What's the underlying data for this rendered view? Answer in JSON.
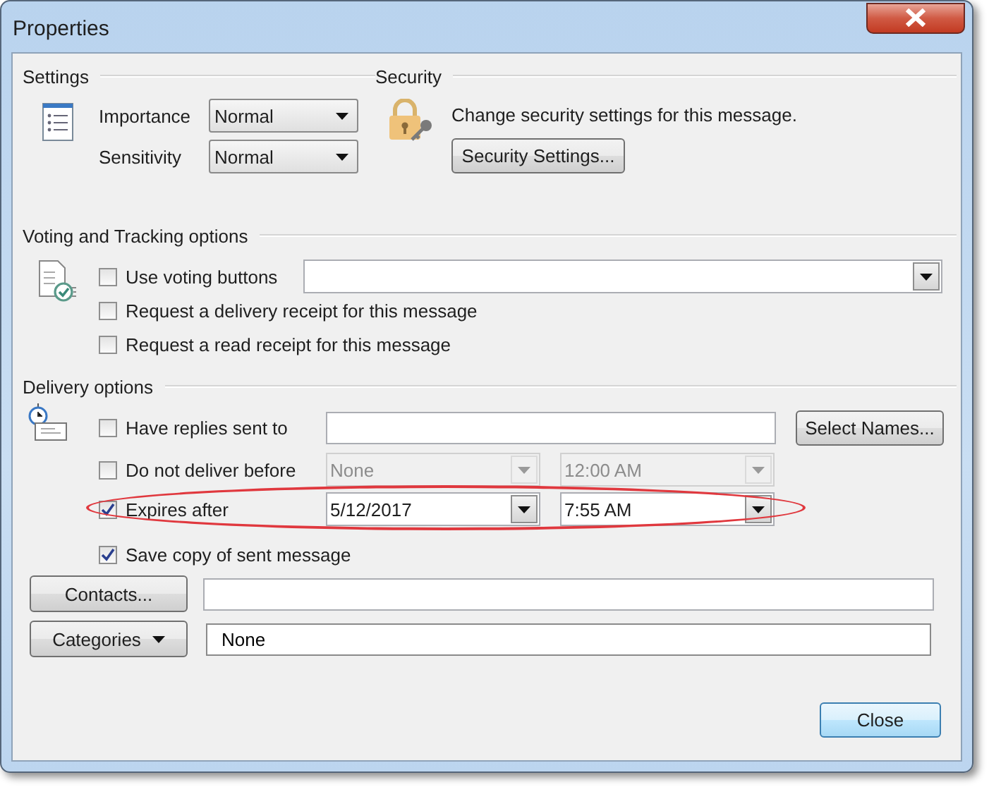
{
  "window": {
    "title": "Properties"
  },
  "settings": {
    "heading": "Settings",
    "fields": [
      {
        "label": "Importance",
        "value": "Normal"
      },
      {
        "label": "Sensitivity",
        "value": "Normal"
      }
    ]
  },
  "security": {
    "heading": "Security",
    "text": "Change security settings for this message.",
    "button": "Security Settings..."
  },
  "voting": {
    "heading": "Voting and Tracking options",
    "options": [
      {
        "kind": "combo",
        "label": "Use voting buttons",
        "checked": false
      },
      {
        "kind": "plain",
        "label": "Request a delivery receipt for this message",
        "checked": false
      },
      {
        "kind": "plain",
        "label": "Request a read receipt for this message",
        "checked": false
      }
    ]
  },
  "delivery": {
    "heading": "Delivery options",
    "rows": [
      {
        "kind": "replies",
        "label": "Have replies sent to",
        "checked": false,
        "button": "Select Names..."
      },
      {
        "kind": "schedule",
        "label": "Do not deliver before",
        "checked": false,
        "disabled": true,
        "date": "None",
        "time": "12:00 AM",
        "highlighted": false
      },
      {
        "kind": "schedule",
        "label": "Expires after",
        "checked": true,
        "disabled": false,
        "date": "5/12/2017",
        "time": "7:55 AM",
        "highlighted": true
      },
      {
        "kind": "plain",
        "label": "Save copy of sent message",
        "checked": true
      }
    ],
    "contacts_button": "Contacts...",
    "categories": {
      "button": "Categories",
      "value": "None"
    }
  },
  "buttons": [
    "Close"
  ]
}
